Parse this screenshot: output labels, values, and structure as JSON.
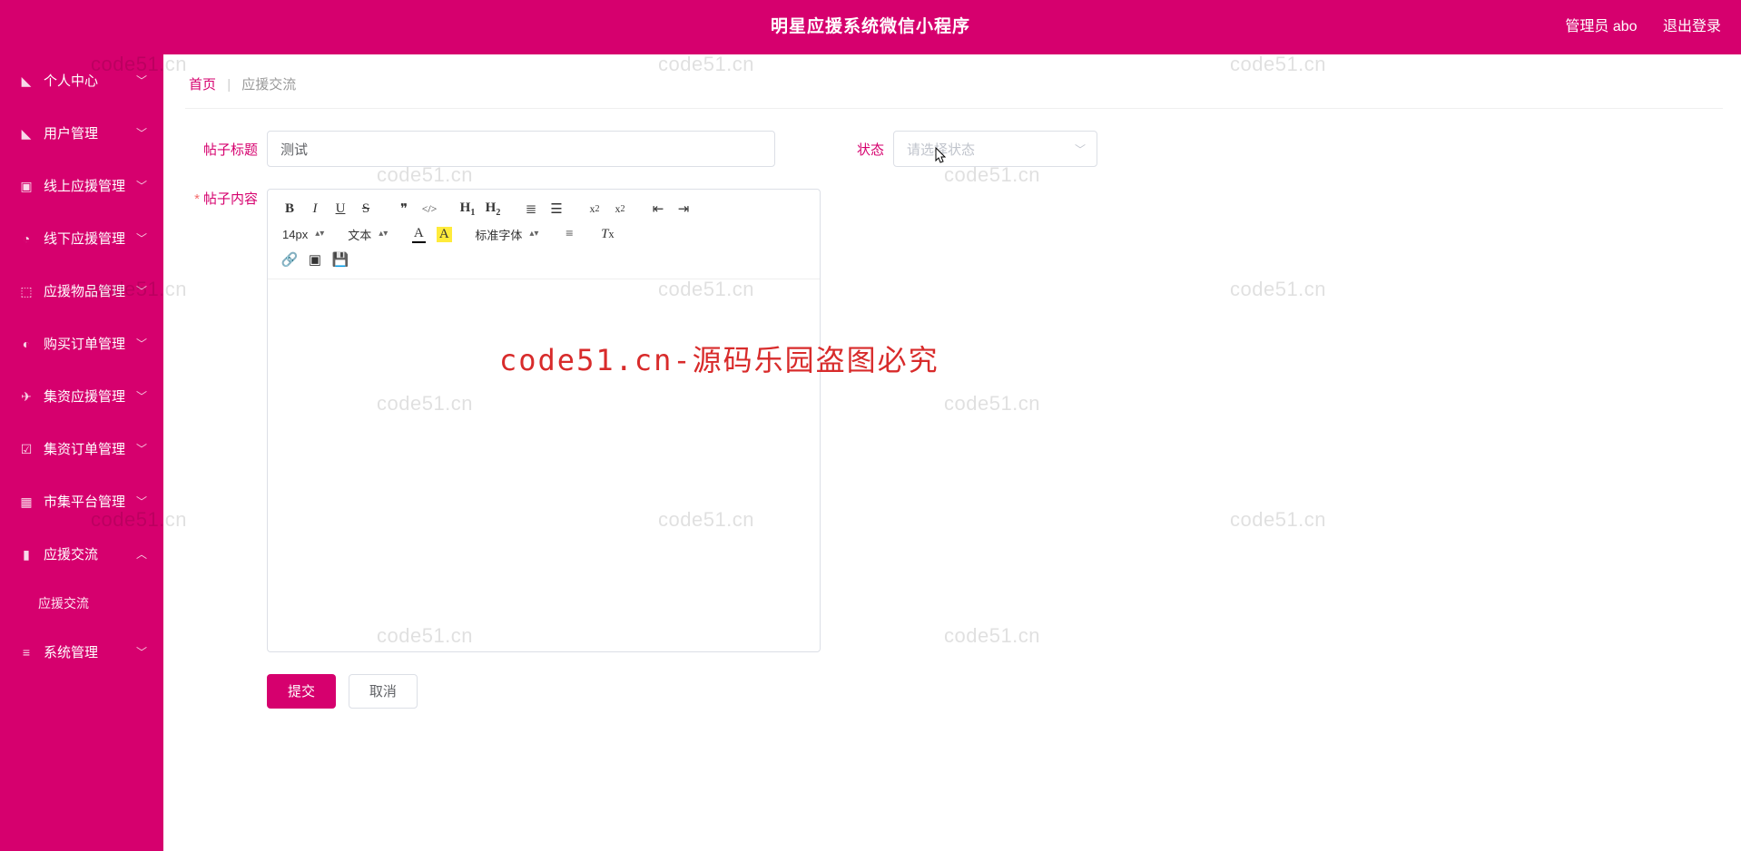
{
  "header": {
    "title": "明星应援系统微信小程序",
    "user_label": "管理员 abo",
    "logout": "退出登录"
  },
  "sidebar": {
    "items": [
      {
        "icon": "person",
        "label": "个人中心",
        "expanded": false
      },
      {
        "icon": "users",
        "label": "用户管理",
        "expanded": false
      },
      {
        "icon": "clipboard",
        "label": "线上应援管理",
        "expanded": false
      },
      {
        "icon": "clock",
        "label": "线下应援管理",
        "expanded": false
      },
      {
        "icon": "mic",
        "label": "应援物品管理",
        "expanded": false
      },
      {
        "icon": "cart",
        "label": "购买订单管理",
        "expanded": false
      },
      {
        "icon": "send",
        "label": "集资应援管理",
        "expanded": false
      },
      {
        "icon": "check",
        "label": "集资订单管理",
        "expanded": false
      },
      {
        "icon": "grid",
        "label": "市集平台管理",
        "expanded": false
      },
      {
        "icon": "bars",
        "label": "应援交流",
        "expanded": true,
        "sub": [
          {
            "label": "应援交流"
          }
        ]
      },
      {
        "icon": "menu",
        "label": "系统管理",
        "expanded": false
      }
    ]
  },
  "breadcrumb": {
    "home": "首页",
    "sep": "|",
    "current": "应援交流"
  },
  "form": {
    "title_label": "帖子标题",
    "title_value": "测试",
    "status_label": "状态",
    "status_placeholder": "请选择状态",
    "content_label": "帖子内容",
    "submit": "提交",
    "cancel": "取消"
  },
  "editor_toolbar": {
    "fontsize": "14px",
    "para": "文本",
    "fontfamily": "标准字体"
  },
  "watermark": {
    "text": "code51.cn",
    "big": "code51.cn-源码乐园盗图必究"
  },
  "icon_glyph": {
    "person": "▲",
    "users": "▲",
    "clipboard": "▣",
    "clock": "◔",
    "mic": "⍵",
    "cart": "◐",
    "send": "✈",
    "check": "☑",
    "grid": "▦",
    "bars": "▮",
    "menu": "≡"
  }
}
